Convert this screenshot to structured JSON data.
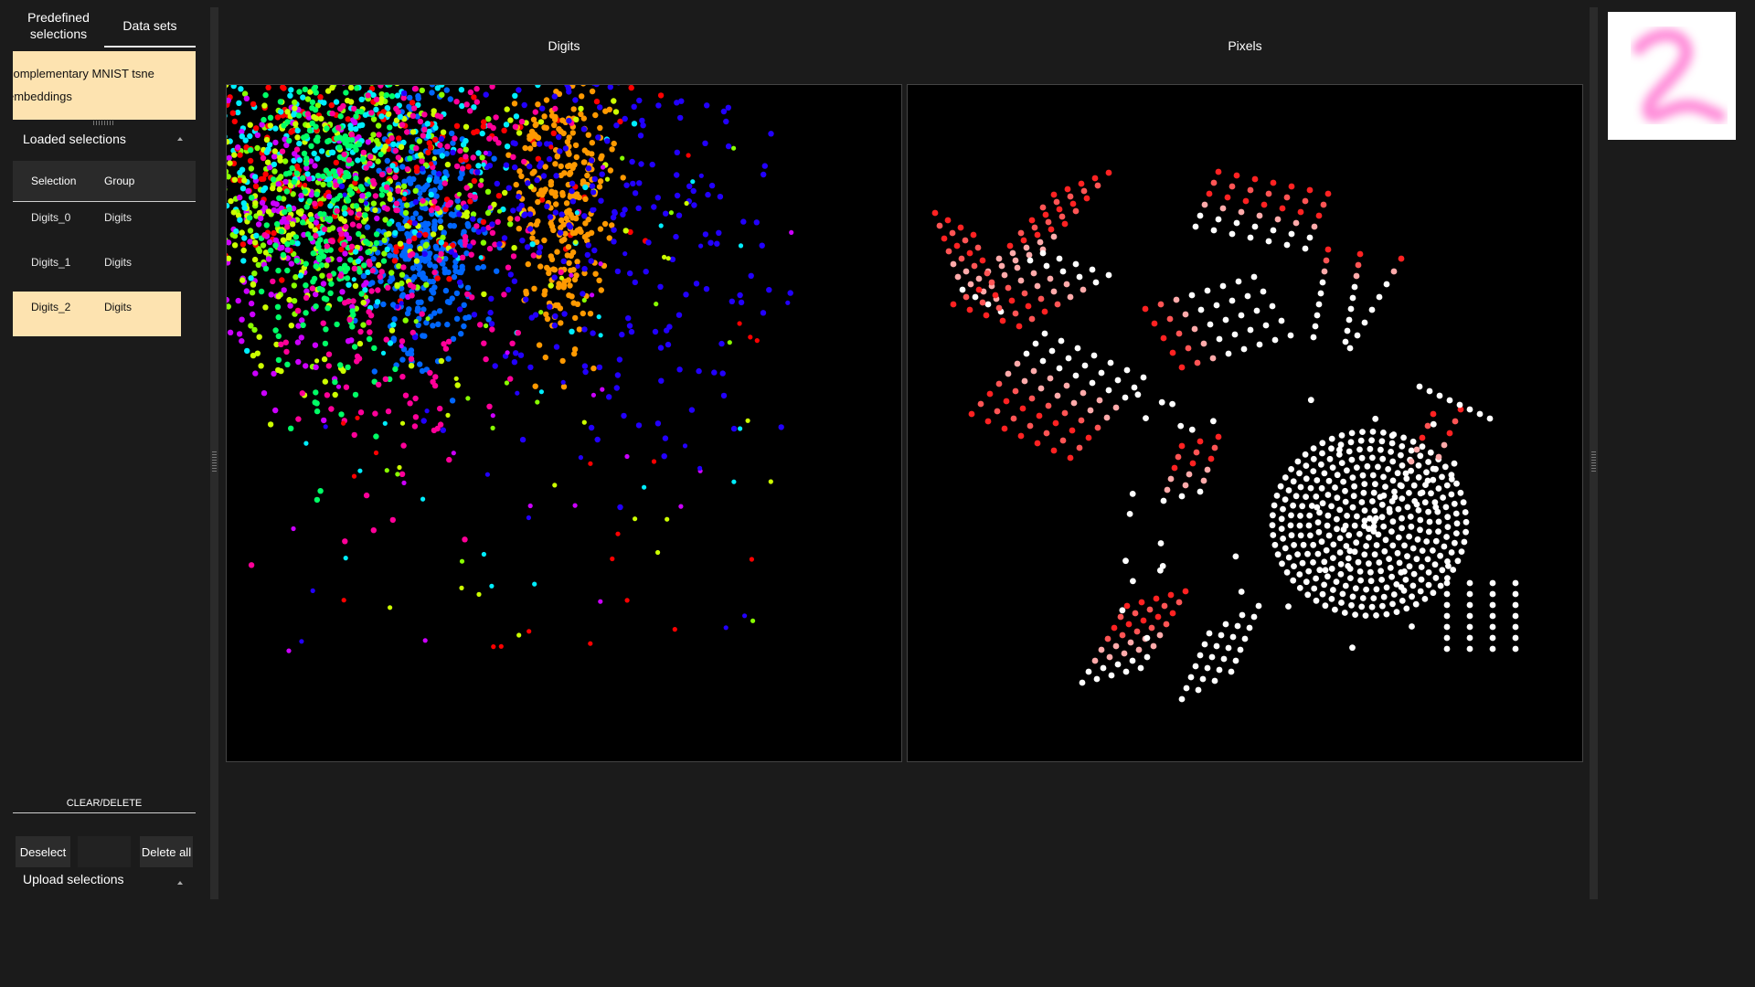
{
  "sidebar": {
    "tabs": [
      {
        "label": "Predefined selections"
      },
      {
        "label": "Data sets"
      }
    ],
    "dataset_item": "complementary MNIST tsne embeddings",
    "loaded_selections": {
      "title": "Loaded selections",
      "columns": [
        "Selection",
        "Group"
      ],
      "rows": [
        {
          "selection": "Digits_0",
          "group": "Digits",
          "selected": false
        },
        {
          "selection": "Digits_1",
          "group": "Digits",
          "selected": false
        },
        {
          "selection": "Digits_2",
          "group": "Digits",
          "selected": true
        }
      ]
    },
    "clear_delete_label": "CLEAR/DELETE",
    "buttons": {
      "deselect": "Deselect",
      "delete_all": "Delete all"
    },
    "upload_title": "Upload selections"
  },
  "plots": {
    "left_title": "Digits",
    "right_title": "Pixels"
  },
  "colors": {
    "panel_bg": "#1b1b1b",
    "highlight": "#fde3b0",
    "plot_bg": "#000000",
    "digit_0": "#0066ff",
    "digit_1": "#00eeff",
    "digit_2": "#88ff00",
    "digit_3": "#ff0000",
    "digit_4": "#cc00ff",
    "digit_5": "#ff9900",
    "digit_6": "#ccff00",
    "digit_7": "#00ff66",
    "digit_8": "#ff0099",
    "digit_9": "#2200ff"
  },
  "thumbnail": {
    "digit": "2",
    "color": "#ff66cc"
  }
}
